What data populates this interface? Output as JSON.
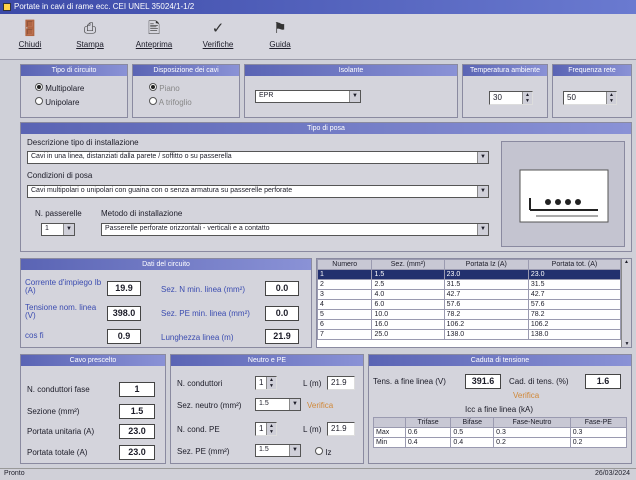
{
  "window": {
    "title": "Portate in cavi di rame ecc. CEI UNEL 35024/1-1/2"
  },
  "toolbar": [
    {
      "label": "Chiudi",
      "icon": "door-icon"
    },
    {
      "label": "Stampa",
      "icon": "printer-icon"
    },
    {
      "label": "Anteprima",
      "icon": "preview-icon"
    },
    {
      "label": "Verifiche",
      "icon": "check-icon"
    },
    {
      "label": "Guida",
      "icon": "help-icon"
    }
  ],
  "tipo_circuito": {
    "header": "Tipo di circuito",
    "options": [
      {
        "label": "Multipolare",
        "selected": true
      },
      {
        "label": "Unipolare",
        "selected": false
      }
    ]
  },
  "disposizione": {
    "header": "Disposizione dei cavi",
    "options": [
      {
        "label": "Piano",
        "selected": true
      },
      {
        "label": "A trifoglio",
        "selected": false
      }
    ]
  },
  "isolante": {
    "header": "Isolante",
    "value": "EPR"
  },
  "temperatura": {
    "header": "Temperatura ambiente",
    "value": "30"
  },
  "frequenza": {
    "header": "Frequenza rete",
    "value": "50"
  },
  "tipo_posa": {
    "header": "Tipo di posa",
    "descr_label": "Descrizione tipo di installazione",
    "descr_value": "Cavi in una linea, distanziati dalla parete / soffitto o su passerella",
    "cond_label": "Condizioni di posa",
    "cond_value": "Cavi multipolari o unipolari con guaina con o senza armatura su passerelle perforate",
    "n_label": "N. passerelle",
    "n_value": "1",
    "metodo_label": "Metodo di installazione",
    "metodo_value": "Passerelle perforate orizzontali - verticali e a contatto"
  },
  "dati_circuito": {
    "header": "Dati del circuito",
    "fields": [
      {
        "label": "Corrente d'impiego Ib (A)",
        "value": "19.9"
      },
      {
        "label": "Tensione nom. linea (V)",
        "value": "398.0"
      },
      {
        "label": "cos fi",
        "value": "0.9"
      }
    ],
    "extra_fields": [
      {
        "label": "Sez. N min. linea (mm²)",
        "value": "0.0"
      },
      {
        "label": "Sez. PE min. linea (mm²)",
        "value": "0.0"
      },
      {
        "label": "Lunghezza linea (m)",
        "value": "21.9"
      }
    ]
  },
  "tabella": {
    "columns": [
      "Numero",
      "Sez. (mm²)",
      "Portata Iz (A)",
      "Portata tot. (A)"
    ],
    "rows": [
      [
        "1",
        "1.5",
        "23.0",
        "23.0"
      ],
      [
        "2",
        "2.5",
        "31.5",
        "31.5"
      ],
      [
        "3",
        "4.0",
        "42.7",
        "42.7"
      ],
      [
        "4",
        "6.0",
        "57.6",
        "57.6"
      ],
      [
        "5",
        "10.0",
        "78.2",
        "78.2"
      ],
      [
        "6",
        "16.0",
        "106.2",
        "106.2"
      ],
      [
        "7",
        "25.0",
        "138.0",
        "138.0"
      ]
    ],
    "selected_row": 0
  },
  "cavo_prescelto": {
    "header": "Cavo prescelto",
    "fields": [
      {
        "label": "N. conduttori fase",
        "value": "1"
      },
      {
        "label": "Sezione (mm²)",
        "value": "1.5"
      },
      {
        "label": "Portata unitaria (A)",
        "value": "23.0"
      },
      {
        "label": "Portata totale (A)",
        "value": "23.0"
      }
    ]
  },
  "neutro_pe": {
    "header": "Neutro e PE",
    "n_conduttori_label": "N. conduttori",
    "n_conduttori_value": "1",
    "l_label": "L (m)",
    "l_value": "21.9",
    "sez_neutro_label": "Sez. neutro (mm²)",
    "sez_neutro_value": "1.5",
    "sez_neutro_note": "Verifica",
    "n_pe_label": "N. cond. PE",
    "n_pe_value": "1",
    "l_pe_label": "L (m)",
    "l_pe_value": "21.9",
    "sez_pe_label": "Sez. PE (mm²)",
    "sez_pe_value": "1.5",
    "check_label": "Iz"
  },
  "caduta_tensione": {
    "header": "Caduta di tensione",
    "tens_label": "Tens. a fine linea (V)",
    "tens_value": "391.6",
    "cad_label": "Cad. di tens. (%)",
    "cad_value": "1.6",
    "note": "Verifica",
    "grid_title": "Icc a fine linea (kA)",
    "grid_columns": [
      "",
      "Trifase",
      "Bifase",
      "Fase-Neutro",
      "Fase-PE"
    ],
    "grid_rows": [
      [
        "Max",
        "0.6",
        "0.5",
        "0.3",
        "0.3"
      ],
      [
        "Min",
        "0.4",
        "0.4",
        "0.2",
        "0.2"
      ]
    ]
  },
  "status": {
    "left": "Pronto",
    "right": "26/03/2024"
  }
}
